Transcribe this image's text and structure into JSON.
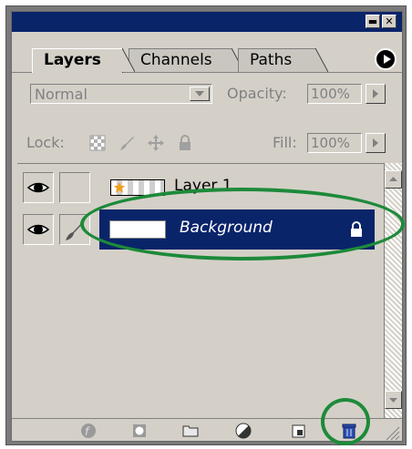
{
  "window": {
    "minimize_glyph": "▬",
    "close_glyph": "✕"
  },
  "tabs": [
    {
      "label": "Layers",
      "active": true
    },
    {
      "label": "Channels",
      "active": false
    },
    {
      "label": "Paths",
      "active": false
    }
  ],
  "blend_mode": {
    "value": "Normal"
  },
  "opacity": {
    "label": "Opacity:",
    "value": "100%"
  },
  "lock": {
    "label": "Lock:"
  },
  "fill": {
    "label": "Fill:",
    "value": "100%"
  },
  "layers": [
    {
      "name": "Layer 1",
      "visible": true,
      "selected": false
    },
    {
      "name": "Background",
      "visible": true,
      "selected": true,
      "locked": true
    }
  ],
  "bottom_icons": [
    "layer-style-icon",
    "mask-icon",
    "folder-icon",
    "adjustment-layer-icon",
    "new-layer-icon",
    "trash-icon"
  ],
  "colors": {
    "selection": "#0a246a",
    "highlight_ring": "#1d8a3a",
    "panel": "#d4d0c8"
  }
}
